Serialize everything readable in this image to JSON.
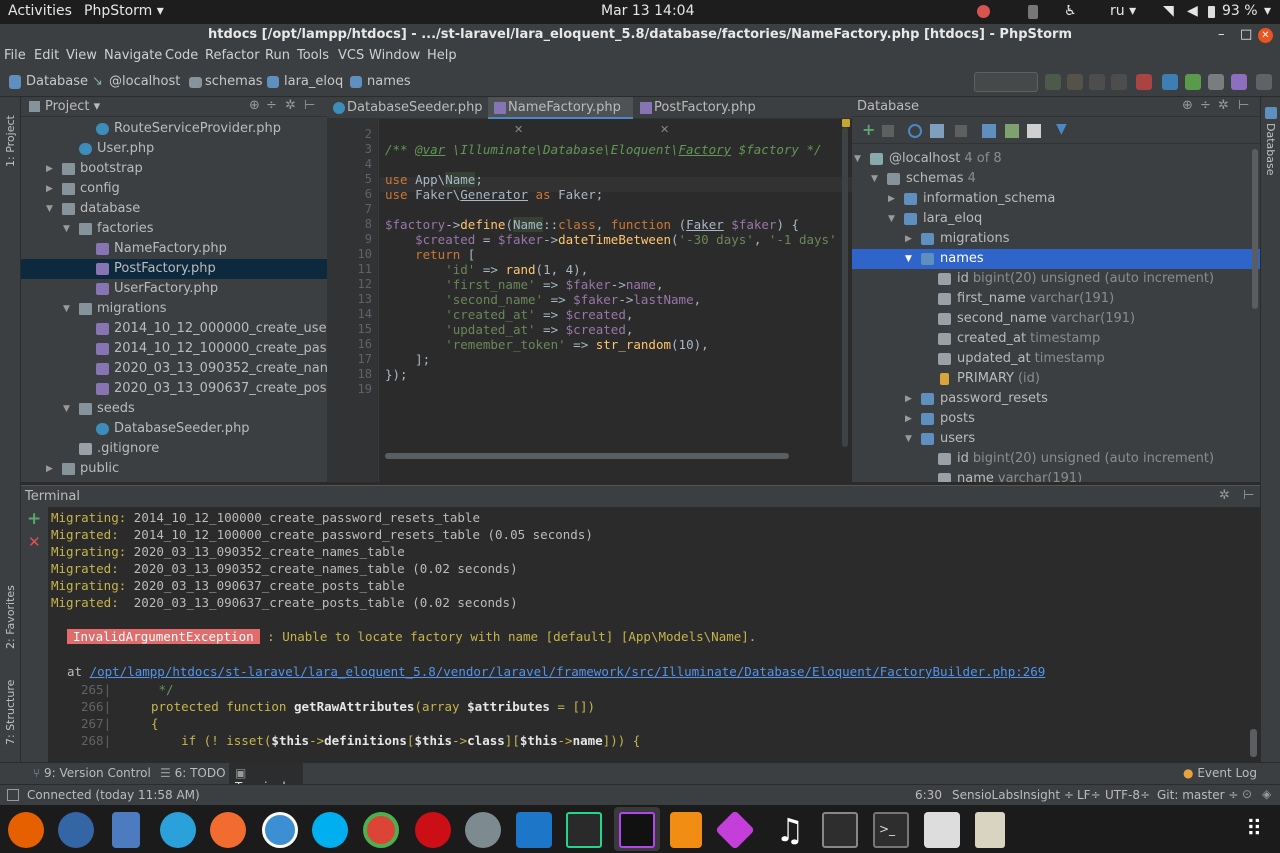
{
  "topbar": {
    "activities": "Activities",
    "app": "PhpStorm ▾",
    "clock": "Mar 13  14:04",
    "lang": "ru ▾",
    "battery": "93 %"
  },
  "window": {
    "title": "htdocs [/opt/lampp/htdocs] - .../st-laravel/lara_eloquent_5.8/database/factories/NameFactory.php [htdocs] - PhpStorm"
  },
  "menu": [
    "File",
    "Edit",
    "View",
    "Navigate",
    "Code",
    "Refactor",
    "Run",
    "Tools",
    "VCS",
    "Window",
    "Help"
  ],
  "breadcrumbs": [
    "Database",
    "@localhost",
    "schemas",
    "lara_eloq",
    "names"
  ],
  "left_strip": {
    "project": "1: Project",
    "favorites": "2: Favorites",
    "structure": "7: Structure"
  },
  "right_strip": {
    "database": "Database"
  },
  "project": {
    "title": "Project ▾",
    "items": [
      {
        "label": "RouteServiceProvider.php",
        "type": "phpc",
        "depth": 5,
        "arrow": ""
      },
      {
        "label": "User.php",
        "type": "phpc",
        "depth": 4,
        "arrow": ""
      },
      {
        "label": "bootstrap",
        "type": "folder",
        "depth": 3,
        "arrow": "▶"
      },
      {
        "label": "config",
        "type": "folder",
        "depth": 3,
        "arrow": "▶"
      },
      {
        "label": "database",
        "type": "folder",
        "depth": 3,
        "arrow": "▼"
      },
      {
        "label": "factories",
        "type": "folder",
        "depth": 4,
        "arrow": "▼"
      },
      {
        "label": "NameFactory.php",
        "type": "mig",
        "depth": 5,
        "arrow": ""
      },
      {
        "label": "PostFactory.php",
        "type": "mig",
        "depth": 5,
        "arrow": "",
        "selected": true
      },
      {
        "label": "UserFactory.php",
        "type": "mig",
        "depth": 5,
        "arrow": ""
      },
      {
        "label": "migrations",
        "type": "folder",
        "depth": 4,
        "arrow": "▼"
      },
      {
        "label": "2014_10_12_000000_create_use",
        "type": "mig",
        "depth": 5,
        "arrow": ""
      },
      {
        "label": "2014_10_12_100000_create_pas",
        "type": "mig",
        "depth": 5,
        "arrow": ""
      },
      {
        "label": "2020_03_13_090352_create_nan",
        "type": "mig",
        "depth": 5,
        "arrow": ""
      },
      {
        "label": "2020_03_13_090637_create_pos",
        "type": "mig",
        "depth": 5,
        "arrow": ""
      },
      {
        "label": "seeds",
        "type": "folder",
        "depth": 4,
        "arrow": "▼"
      },
      {
        "label": "DatabaseSeeder.php",
        "type": "phpc",
        "depth": 5,
        "arrow": ""
      },
      {
        "label": ".gitignore",
        "type": "file",
        "depth": 4,
        "arrow": ""
      },
      {
        "label": "public",
        "type": "folder",
        "depth": 3,
        "arrow": "▶"
      }
    ]
  },
  "editor": {
    "tabs": [
      "DatabaseSeeder.php",
      "NameFactory.php",
      "PostFactory.php"
    ],
    "active_tab": 1,
    "line_numbers": [
      "2",
      "3",
      "4",
      "5",
      "6",
      "7",
      "8",
      "9",
      "10",
      "11",
      "12",
      "13",
      "14",
      "15",
      "16",
      "17",
      "18",
      "19"
    ]
  },
  "database": {
    "title": "Database",
    "items": [
      {
        "name": "@localhost",
        "extra": "4 of 8",
        "depth": 0,
        "arrow": "▼",
        "icon": "host"
      },
      {
        "name": "schemas",
        "extra": "4",
        "depth": 1,
        "arrow": "▼",
        "icon": "folder"
      },
      {
        "name": "information_schema",
        "extra": "",
        "depth": 2,
        "arrow": "▶",
        "icon": "schema"
      },
      {
        "name": "lara_eloq",
        "extra": "",
        "depth": 2,
        "arrow": "▼",
        "icon": "schema"
      },
      {
        "name": "migrations",
        "extra": "",
        "depth": 3,
        "arrow": "▶",
        "icon": "table"
      },
      {
        "name": "names",
        "extra": "",
        "depth": 3,
        "arrow": "▼",
        "icon": "table",
        "selected": true
      },
      {
        "name": "id",
        "extra": "bigint(20) unsigned (auto increment)",
        "depth": 4,
        "arrow": "",
        "icon": "col-key"
      },
      {
        "name": "first_name",
        "extra": "varchar(191)",
        "depth": 4,
        "arrow": "",
        "icon": "col"
      },
      {
        "name": "second_name",
        "extra": "varchar(191)",
        "depth": 4,
        "arrow": "",
        "icon": "col"
      },
      {
        "name": "created_at",
        "extra": "timestamp",
        "depth": 4,
        "arrow": "",
        "icon": "col"
      },
      {
        "name": "updated_at",
        "extra": "timestamp",
        "depth": 4,
        "arrow": "",
        "icon": "col"
      },
      {
        "name": "PRIMARY",
        "extra": "(id)",
        "depth": 4,
        "arrow": "",
        "icon": "key"
      },
      {
        "name": "password_resets",
        "extra": "",
        "depth": 3,
        "arrow": "▶",
        "icon": "table"
      },
      {
        "name": "posts",
        "extra": "",
        "depth": 3,
        "arrow": "▶",
        "icon": "table"
      },
      {
        "name": "users",
        "extra": "",
        "depth": 3,
        "arrow": "▼",
        "icon": "table"
      },
      {
        "name": "id",
        "extra": "bigint(20) unsigned (auto increment)",
        "depth": 4,
        "arrow": "",
        "icon": "col-key"
      },
      {
        "name": "name",
        "extra": "varchar(191)",
        "depth": 4,
        "arrow": "",
        "icon": "col"
      }
    ]
  },
  "terminal": {
    "title": "Terminal",
    "lines": [
      {
        "k": "Migrating:",
        "v": " 2014_10_12_100000_create_password_resets_table"
      },
      {
        "k": "Migrated:",
        "v": "  2014_10_12_100000_create_password_resets_table (0.05 seconds)"
      },
      {
        "k": "Migrating:",
        "v": " 2020_03_13_090352_create_names_table"
      },
      {
        "k": "Migrated:",
        "v": "  2020_03_13_090352_create_names_table (0.02 seconds)"
      },
      {
        "k": "Migrating:",
        "v": " 2020_03_13_090637_create_posts_table"
      },
      {
        "k": "Migrated:",
        "v": "  2020_03_13_090637_create_posts_table (0.02 seconds)"
      }
    ],
    "exception": "InvalidArgumentException",
    "message": " : Unable to locate factory with name [default] [App\\Models\\Name].",
    "at": "at ",
    "path": "/opt/lampp/htdocs/st-laravel/lara_eloquent_5.8/vendor/laravel/framework/src/Illuminate/Database/Eloquent/FactoryBuilder.php:269",
    "snippet_lines": [
      "265",
      "266",
      "267",
      "268"
    ]
  },
  "bottom_tools": {
    "version_control": "9: Version Control",
    "todo": "6: TODO",
    "terminal": "Terminal",
    "event_log": "Event Log"
  },
  "status": {
    "connected": "Connected (today 11:58 AM)",
    "pos": "6:30",
    "insight": "SensioLabsInsight ÷",
    "lf": "LF÷",
    "enc": "UTF-8÷",
    "git": "Git: master ÷"
  }
}
